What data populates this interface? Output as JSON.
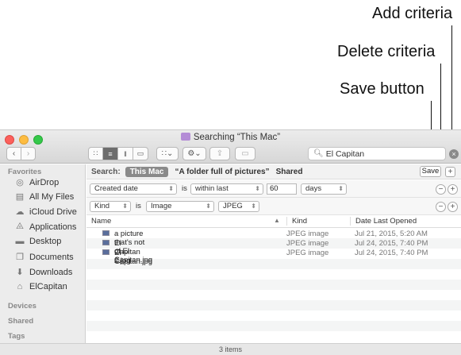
{
  "callouts": {
    "add": "Add criteria",
    "delete": "Delete criteria",
    "save": "Save button"
  },
  "window": {
    "title": "Searching “This Mac”",
    "search_value": "El Capitan"
  },
  "sidebar": {
    "favorites_header": "Favorites",
    "items": [
      {
        "label": "AirDrop",
        "icon": "airdrop-icon"
      },
      {
        "label": "All My Files",
        "icon": "all-files-icon"
      },
      {
        "label": "iCloud Drive",
        "icon": "cloud-icon"
      },
      {
        "label": "Applications",
        "icon": "applications-icon"
      },
      {
        "label": "Desktop",
        "icon": "desktop-icon"
      },
      {
        "label": "Documents",
        "icon": "documents-icon"
      },
      {
        "label": "Downloads",
        "icon": "downloads-icon"
      },
      {
        "label": "ElCapitan",
        "icon": "home-icon"
      }
    ],
    "devices_header": "Devices",
    "shared_header": "Shared",
    "tags_header": "Tags"
  },
  "search_bar": {
    "label": "Search:",
    "scope_this_mac": "This Mac",
    "scope_folder": "“A folder full of pictures”",
    "scope_shared": "Shared",
    "save_label": "Save"
  },
  "criteria": [
    {
      "attribute": "Created date",
      "operator_text": "is",
      "operator": "within last",
      "value": "60",
      "unit": "days"
    },
    {
      "attribute": "Kind",
      "operator_text": "is",
      "operator": "Image",
      "value": "JPEG"
    }
  ],
  "columns": {
    "name": "Name",
    "kind": "Kind",
    "date": "Date Last Opened"
  },
  "files": [
    {
      "name": "a picture that's not of El Capitan.jpg",
      "kind": "JPEG image",
      "date": "Jul 21, 2015, 5:20 AM"
    },
    {
      "name": "El Capitan 2.jpg",
      "kind": "JPEG image",
      "date": "Jul 24, 2015, 7:40 PM"
    },
    {
      "name": "El Capitan.jpg",
      "kind": "JPEG image",
      "date": "Jul 24, 2015, 7:40 PM"
    }
  ],
  "status_text": "3 items"
}
